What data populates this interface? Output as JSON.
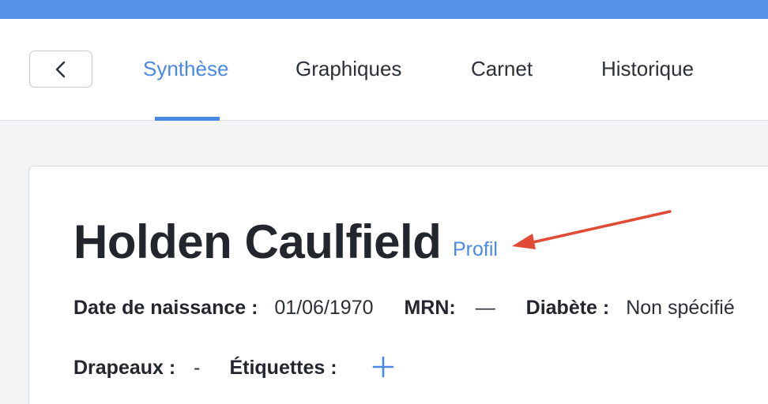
{
  "nav": {
    "tabs": [
      {
        "label": "Synthèse",
        "active": true
      },
      {
        "label": "Graphiques",
        "active": false
      },
      {
        "label": "Carnet",
        "active": false
      },
      {
        "label": "Historique",
        "active": false
      }
    ]
  },
  "patient": {
    "name": "Holden Caulfield",
    "profile_link": "Profil",
    "dob_label": "Date de naissance :",
    "dob_value": "01/06/1970",
    "mrn_label": "MRN:",
    "mrn_value": "—",
    "diabetes_label": "Diabète :",
    "diabetes_value": "Non spécifié",
    "flags_label": "Drapeaux :",
    "flags_value": "-",
    "tags_label": "Étiquettes :"
  },
  "colors": {
    "accent": "#4a89e3",
    "top_bar": "#5691e8",
    "annotation_arrow": "#e04b36"
  },
  "icons": {
    "back": "chevron-left-icon",
    "add_tag": "plus-icon"
  }
}
